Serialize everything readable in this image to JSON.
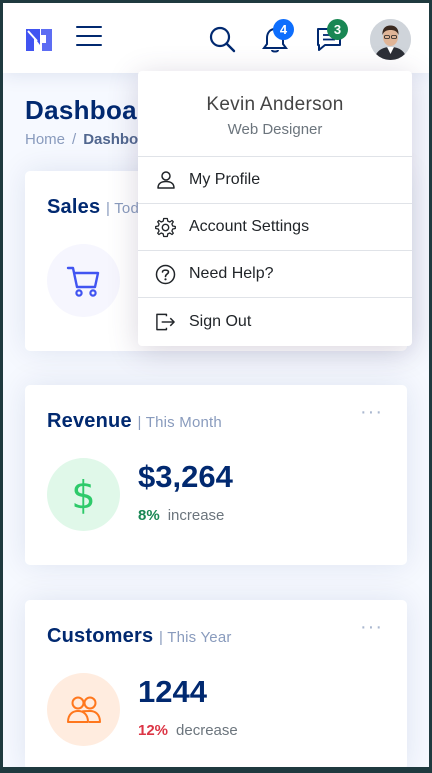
{
  "header": {
    "logo_icon": "logo-icon",
    "menu_icon": "hamburger-icon",
    "search_icon": "search-icon",
    "notifications": {
      "icon": "bell-icon",
      "count": "4"
    },
    "messages": {
      "icon": "chat-icon",
      "count": "3"
    },
    "avatar_icon": "avatar"
  },
  "page": {
    "title": "Dashboard",
    "breadcrumb": {
      "home": "Home",
      "separator": "/",
      "current": "Dashboard"
    }
  },
  "cards": {
    "sales": {
      "title": "Sales",
      "period": "| Today",
      "icon": "cart-icon"
    },
    "revenue": {
      "title": "Revenue",
      "period": "| This Month",
      "icon": "dollar-icon",
      "value": "$3,264",
      "change_pct": "8%",
      "change_label": "increase"
    },
    "customers": {
      "title": "Customers",
      "period": "| This Year",
      "icon": "people-icon",
      "value": "1244",
      "change_pct": "12%",
      "change_label": "decrease"
    },
    "more_label": "···"
  },
  "profile_menu": {
    "name": "Kevin Anderson",
    "role": "Web Designer",
    "items": [
      {
        "label": "My Profile",
        "icon": "person-icon"
      },
      {
        "label": "Account Settings",
        "icon": "gear-icon"
      },
      {
        "label": "Need Help?",
        "icon": "question-circle-icon"
      },
      {
        "label": "Sign Out",
        "icon": "sign-out-icon"
      }
    ]
  },
  "colors": {
    "brand_navy": "#012970",
    "accent_blue": "#4154f1",
    "badge_blue": "#0d6efd",
    "badge_green": "#198754",
    "increase_green": "#198754",
    "decrease_red": "#dc3545",
    "revenue_green": "#2eca6a",
    "customers_orange": "#ff771d",
    "page_bg": "#f6f9ff"
  }
}
